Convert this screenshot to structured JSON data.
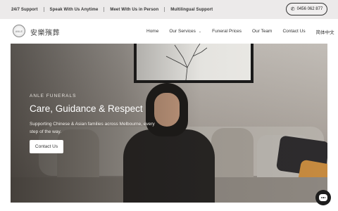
{
  "topbar": {
    "items": [
      "24/7 Support",
      "Speak With Us Anytime",
      "Meet With Us in Person",
      "Multilingual Support"
    ],
    "phone": "0456 062 877",
    "phone_icon": "phone-icon"
  },
  "header": {
    "logo_mark": "ANLE",
    "logo_text": "安樂殯葬",
    "nav": [
      "Home",
      "Our Services",
      "Funeral Prices",
      "Our Team",
      "Contact Us",
      "简体中文"
    ],
    "dropdown_icon": "chevron-down-icon"
  },
  "hero": {
    "eyebrow": "ANLE FUNERALS",
    "headline": "Care, Guidance & Respect",
    "subtext": "Supporting Chinese & Asian families across Melbourne, every step of the way.",
    "cta": "Contact Us"
  },
  "chat": {
    "icon": "chat-icon"
  }
}
